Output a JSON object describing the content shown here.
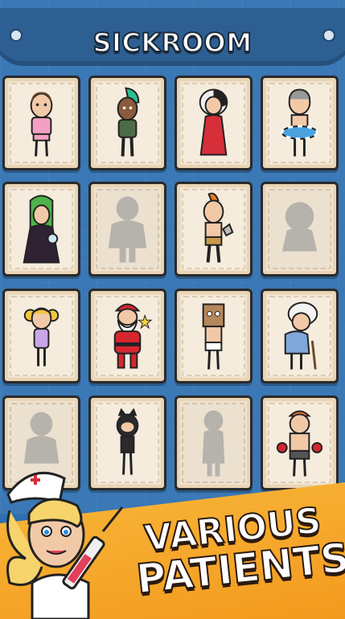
{
  "title": "SICKROOM",
  "promo": {
    "line1": "VARIOUS",
    "line2": "PATIENTS"
  },
  "patients": [
    {
      "name": "bald-man-pink-shirt",
      "unlocked": true
    },
    {
      "name": "punk-green-mohawk",
      "unlocked": true
    },
    {
      "name": "lady-red-dress",
      "unlocked": true
    },
    {
      "name": "man-swim-ring",
      "unlocked": true
    },
    {
      "name": "green-hair-mirror",
      "unlocked": true
    },
    {
      "name": "locked-silhouette",
      "unlocked": false
    },
    {
      "name": "caveman-axe",
      "unlocked": true
    },
    {
      "name": "locked-silhouette",
      "unlocked": false
    },
    {
      "name": "girl-pigtails",
      "unlocked": true
    },
    {
      "name": "santa-claus",
      "unlocked": true
    },
    {
      "name": "paper-bag-head",
      "unlocked": true
    },
    {
      "name": "old-granny",
      "unlocked": true
    },
    {
      "name": "locked-silhouette",
      "unlocked": false
    },
    {
      "name": "cat-mask-girl",
      "unlocked": true
    },
    {
      "name": "locked-silhouette",
      "unlocked": false
    },
    {
      "name": "boxer-man",
      "unlocked": true
    }
  ],
  "colors": {
    "board": "#3a78b6",
    "card": "#f1e3cf",
    "accent": "#f5a623"
  }
}
